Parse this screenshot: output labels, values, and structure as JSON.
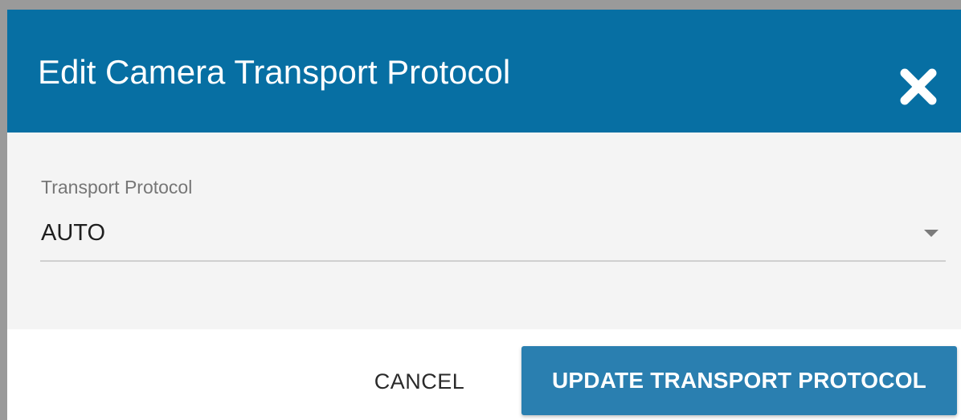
{
  "dialog": {
    "title": "Edit Camera Transport Protocol",
    "close_icon": "close-x-icon"
  },
  "form": {
    "transport_protocol": {
      "label": "Transport Protocol",
      "value": "AUTO",
      "dropdown_icon": "caret-down-icon"
    }
  },
  "footer": {
    "cancel_label": "CANCEL",
    "update_label": "UPDATE TRANSPORT PROTOCOL"
  },
  "colors": {
    "header_bg": "#076fa3",
    "primary_button": "#2a7fb0",
    "body_bg": "#f4f4f4"
  }
}
